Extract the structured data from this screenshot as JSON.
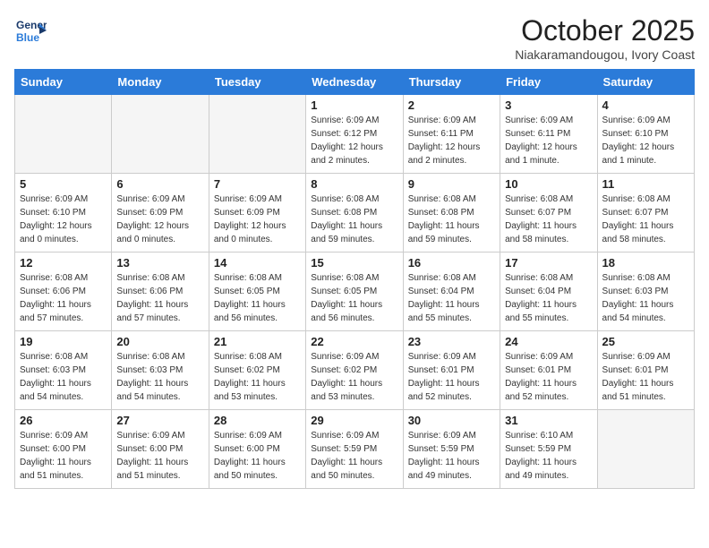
{
  "header": {
    "logo_line1": "General",
    "logo_line2": "Blue",
    "month_title": "October 2025",
    "location": "Niakaramandougou, Ivory Coast"
  },
  "weekdays": [
    "Sunday",
    "Monday",
    "Tuesday",
    "Wednesday",
    "Thursday",
    "Friday",
    "Saturday"
  ],
  "weeks": [
    [
      {
        "day": "",
        "info": ""
      },
      {
        "day": "",
        "info": ""
      },
      {
        "day": "",
        "info": ""
      },
      {
        "day": "1",
        "info": "Sunrise: 6:09 AM\nSunset: 6:12 PM\nDaylight: 12 hours\nand 2 minutes."
      },
      {
        "day": "2",
        "info": "Sunrise: 6:09 AM\nSunset: 6:11 PM\nDaylight: 12 hours\nand 2 minutes."
      },
      {
        "day": "3",
        "info": "Sunrise: 6:09 AM\nSunset: 6:11 PM\nDaylight: 12 hours\nand 1 minute."
      },
      {
        "day": "4",
        "info": "Sunrise: 6:09 AM\nSunset: 6:10 PM\nDaylight: 12 hours\nand 1 minute."
      }
    ],
    [
      {
        "day": "5",
        "info": "Sunrise: 6:09 AM\nSunset: 6:10 PM\nDaylight: 12 hours\nand 0 minutes."
      },
      {
        "day": "6",
        "info": "Sunrise: 6:09 AM\nSunset: 6:09 PM\nDaylight: 12 hours\nand 0 minutes."
      },
      {
        "day": "7",
        "info": "Sunrise: 6:09 AM\nSunset: 6:09 PM\nDaylight: 12 hours\nand 0 minutes."
      },
      {
        "day": "8",
        "info": "Sunrise: 6:08 AM\nSunset: 6:08 PM\nDaylight: 11 hours\nand 59 minutes."
      },
      {
        "day": "9",
        "info": "Sunrise: 6:08 AM\nSunset: 6:08 PM\nDaylight: 11 hours\nand 59 minutes."
      },
      {
        "day": "10",
        "info": "Sunrise: 6:08 AM\nSunset: 6:07 PM\nDaylight: 11 hours\nand 58 minutes."
      },
      {
        "day": "11",
        "info": "Sunrise: 6:08 AM\nSunset: 6:07 PM\nDaylight: 11 hours\nand 58 minutes."
      }
    ],
    [
      {
        "day": "12",
        "info": "Sunrise: 6:08 AM\nSunset: 6:06 PM\nDaylight: 11 hours\nand 57 minutes."
      },
      {
        "day": "13",
        "info": "Sunrise: 6:08 AM\nSunset: 6:06 PM\nDaylight: 11 hours\nand 57 minutes."
      },
      {
        "day": "14",
        "info": "Sunrise: 6:08 AM\nSunset: 6:05 PM\nDaylight: 11 hours\nand 56 minutes."
      },
      {
        "day": "15",
        "info": "Sunrise: 6:08 AM\nSunset: 6:05 PM\nDaylight: 11 hours\nand 56 minutes."
      },
      {
        "day": "16",
        "info": "Sunrise: 6:08 AM\nSunset: 6:04 PM\nDaylight: 11 hours\nand 55 minutes."
      },
      {
        "day": "17",
        "info": "Sunrise: 6:08 AM\nSunset: 6:04 PM\nDaylight: 11 hours\nand 55 minutes."
      },
      {
        "day": "18",
        "info": "Sunrise: 6:08 AM\nSunset: 6:03 PM\nDaylight: 11 hours\nand 54 minutes."
      }
    ],
    [
      {
        "day": "19",
        "info": "Sunrise: 6:08 AM\nSunset: 6:03 PM\nDaylight: 11 hours\nand 54 minutes."
      },
      {
        "day": "20",
        "info": "Sunrise: 6:08 AM\nSunset: 6:03 PM\nDaylight: 11 hours\nand 54 minutes."
      },
      {
        "day": "21",
        "info": "Sunrise: 6:08 AM\nSunset: 6:02 PM\nDaylight: 11 hours\nand 53 minutes."
      },
      {
        "day": "22",
        "info": "Sunrise: 6:09 AM\nSunset: 6:02 PM\nDaylight: 11 hours\nand 53 minutes."
      },
      {
        "day": "23",
        "info": "Sunrise: 6:09 AM\nSunset: 6:01 PM\nDaylight: 11 hours\nand 52 minutes."
      },
      {
        "day": "24",
        "info": "Sunrise: 6:09 AM\nSunset: 6:01 PM\nDaylight: 11 hours\nand 52 minutes."
      },
      {
        "day": "25",
        "info": "Sunrise: 6:09 AM\nSunset: 6:01 PM\nDaylight: 11 hours\nand 51 minutes."
      }
    ],
    [
      {
        "day": "26",
        "info": "Sunrise: 6:09 AM\nSunset: 6:00 PM\nDaylight: 11 hours\nand 51 minutes."
      },
      {
        "day": "27",
        "info": "Sunrise: 6:09 AM\nSunset: 6:00 PM\nDaylight: 11 hours\nand 51 minutes."
      },
      {
        "day": "28",
        "info": "Sunrise: 6:09 AM\nSunset: 6:00 PM\nDaylight: 11 hours\nand 50 minutes."
      },
      {
        "day": "29",
        "info": "Sunrise: 6:09 AM\nSunset: 5:59 PM\nDaylight: 11 hours\nand 50 minutes."
      },
      {
        "day": "30",
        "info": "Sunrise: 6:09 AM\nSunset: 5:59 PM\nDaylight: 11 hours\nand 49 minutes."
      },
      {
        "day": "31",
        "info": "Sunrise: 6:10 AM\nSunset: 5:59 PM\nDaylight: 11 hours\nand 49 minutes."
      },
      {
        "day": "",
        "info": ""
      }
    ]
  ]
}
